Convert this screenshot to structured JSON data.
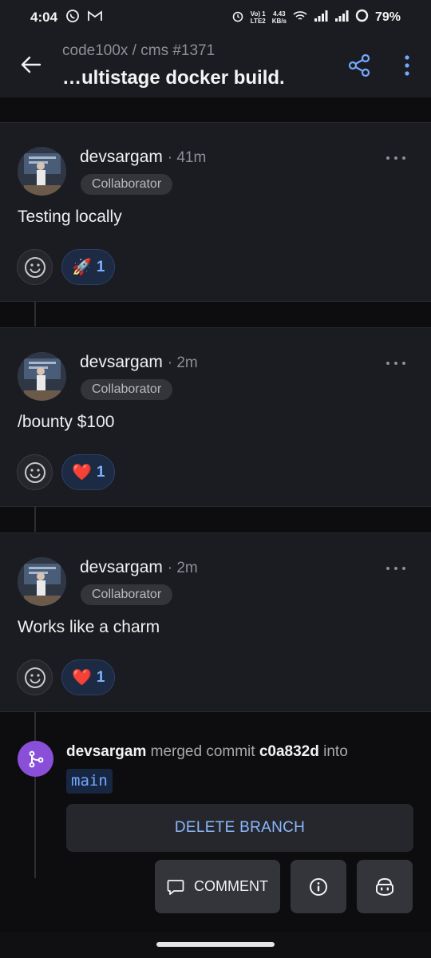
{
  "status_bar": {
    "time": "4:04",
    "volte_top": "Vo) 1",
    "volte_bottom": "LTE2",
    "speed_top": "4.43",
    "speed_bottom": "KB/s",
    "battery": "79%"
  },
  "header": {
    "subtitle": "code100x / cms #1371",
    "title": "…ultistage docker build."
  },
  "comments": [
    {
      "author": "devsargam",
      "time": "· 41m",
      "role": "Collaborator",
      "body": "Testing locally",
      "reaction_emoji": "🚀",
      "reaction_count": "1"
    },
    {
      "author": "devsargam",
      "time": "· 2m",
      "role": "Collaborator",
      "body": "/bounty $100",
      "reaction_emoji": "❤️",
      "reaction_count": "1"
    },
    {
      "author": "devsargam",
      "time": "· 2m",
      "role": "Collaborator",
      "body": "Works like a charm",
      "reaction_emoji": "❤️",
      "reaction_count": "1"
    }
  ],
  "merge_event": {
    "author": "devsargam",
    "action": "merged commit",
    "commit": "c0a832d",
    "into": "into",
    "branch": "main",
    "delete_label": "DELETE BRANCH"
  },
  "actions": {
    "comment_label": "COMMENT"
  },
  "colors": {
    "accent": "#74a9ff",
    "merge_purple": "#8a4fd8",
    "surface": "#1b1c21",
    "background": "#0d0d0f"
  }
}
